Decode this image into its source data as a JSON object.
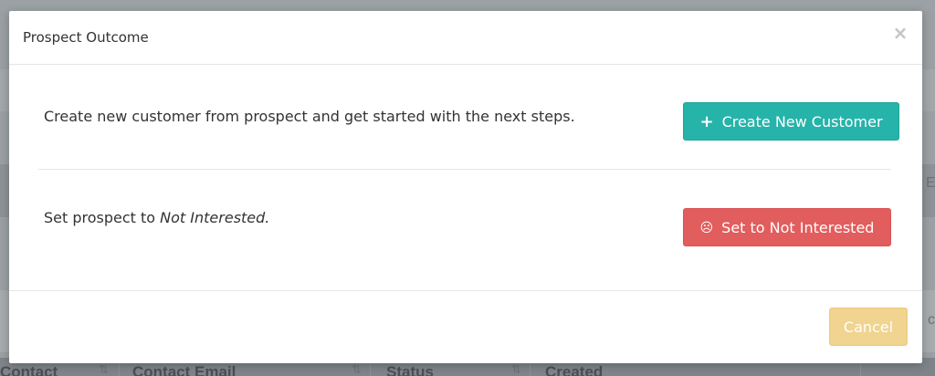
{
  "modal": {
    "title": "Prospect Outcome",
    "close_symbol": "×",
    "rows": [
      {
        "text": "Create new customer from prospect and get started with the next steps.",
        "button": {
          "label": "Create New Customer",
          "icon": "plus-icon",
          "icon_glyph": "+",
          "color": "#26b3aa"
        }
      },
      {
        "text_prefix": "Set prospect to ",
        "text_emphasis": "Not Interested.",
        "button": {
          "label": "Set to Not Interested",
          "icon": "frown-icon",
          "icon_glyph": "☹",
          "color": "#e25d5d"
        }
      }
    ],
    "footer": {
      "cancel_label": "Cancel",
      "cancel_color": "#f0d28a"
    }
  },
  "background": {
    "edge_text_1": "E",
    "edge_text_2": "c",
    "table_headers": [
      "Contact",
      "Contact Email",
      "Status",
      "Created"
    ]
  }
}
